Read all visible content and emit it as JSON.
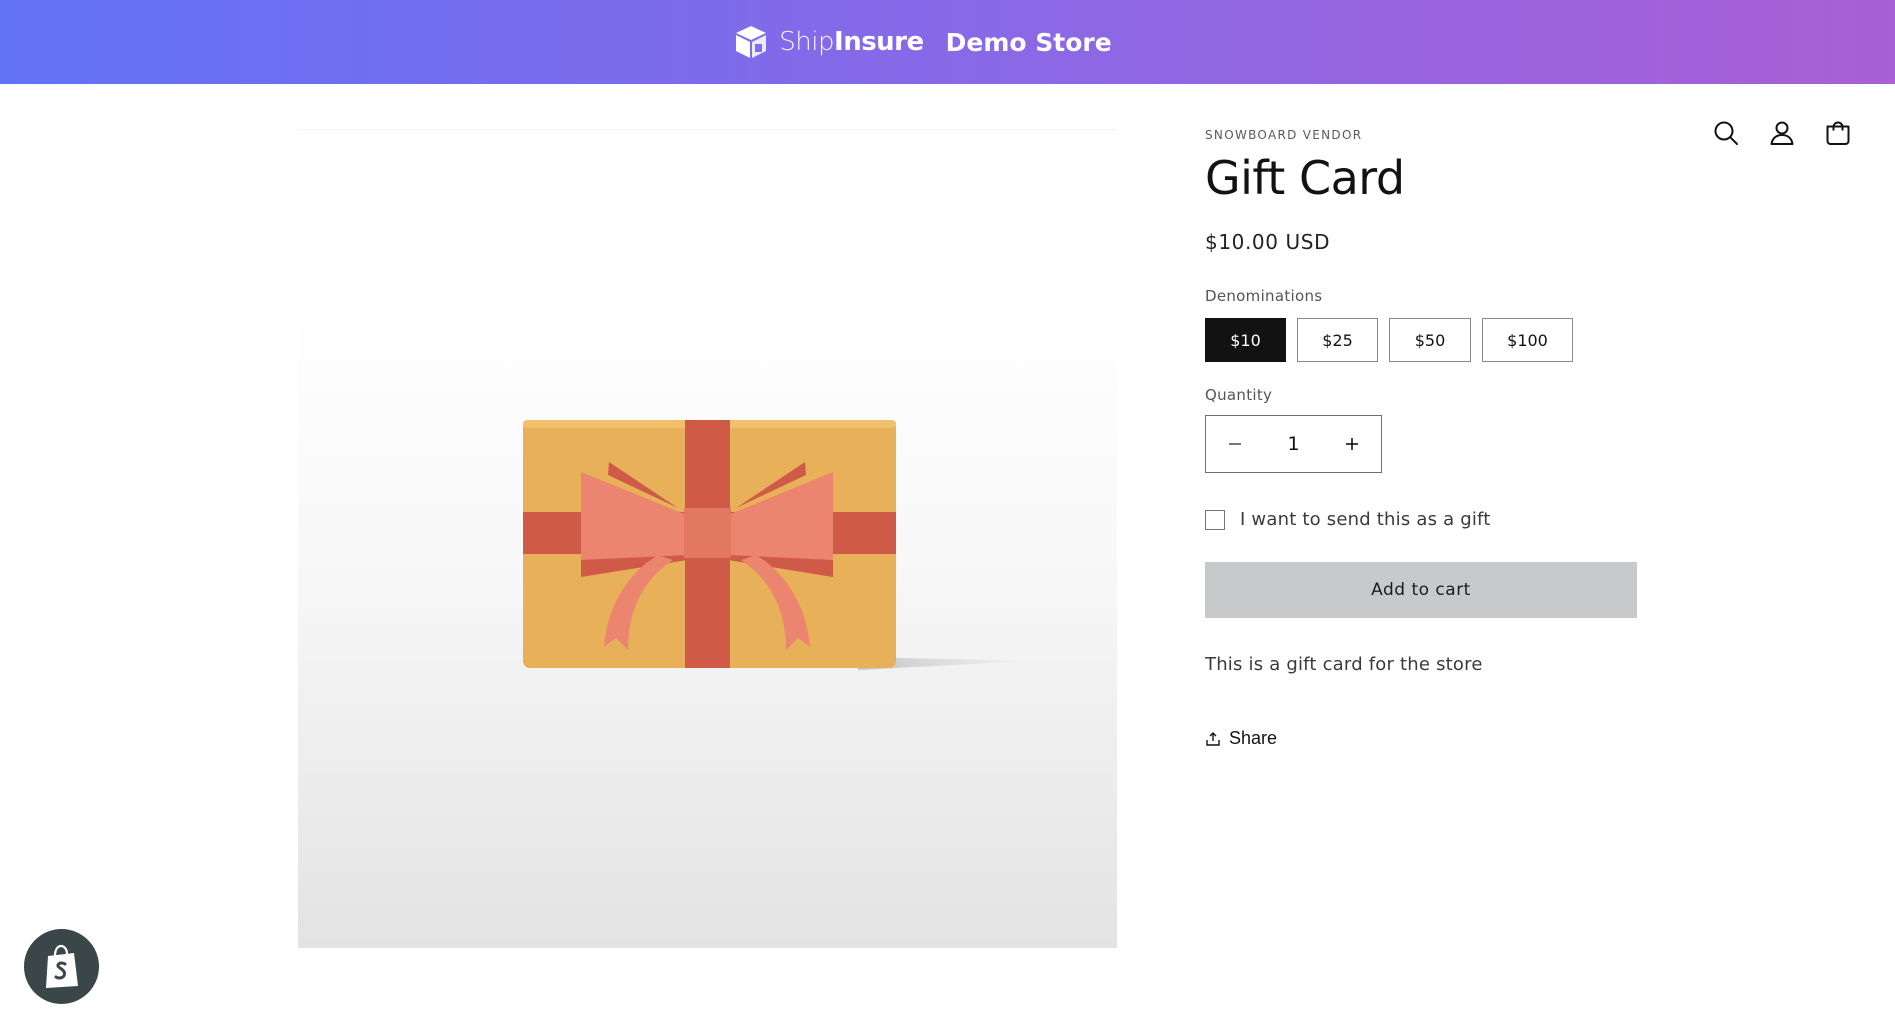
{
  "banner": {
    "logo_icon": "shipinsure-box-logo",
    "brand_light": "Ship",
    "brand_bold": "Insure",
    "store_label": "Demo Store",
    "gradient": [
      "#6272f6",
      "#a95fd6"
    ]
  },
  "header": {
    "icons": [
      "search-icon",
      "account-icon",
      "cart-icon"
    ]
  },
  "product": {
    "vendor": "SNOWBOARD VENDOR",
    "title": "Gift Card",
    "price": "$10.00 USD",
    "denominations_label": "Denominations",
    "denominations": [
      {
        "label": "$10",
        "selected": true
      },
      {
        "label": "$25",
        "selected": false
      },
      {
        "label": "$50",
        "selected": false
      },
      {
        "label": "$100",
        "selected": false
      }
    ],
    "quantity_label": "Quantity",
    "quantity_value": "1",
    "gift_checkbox_label": "I want to send this as a gift",
    "gift_checked": false,
    "add_to_cart_label": "Add to cart",
    "description": "This is a gift card for the store",
    "share_label": "Share",
    "image_icon": "gift-card-image"
  },
  "colors": {
    "accent_selected": "#121212",
    "add_to_cart_bg": "#c8c9cb",
    "gift_box": "#e8b059",
    "ribbon": "#d05a48",
    "bow": "#eb8570",
    "shopify_badge": "#3b4648"
  },
  "floating": {
    "badge_icon": "shopify-bag-icon"
  }
}
